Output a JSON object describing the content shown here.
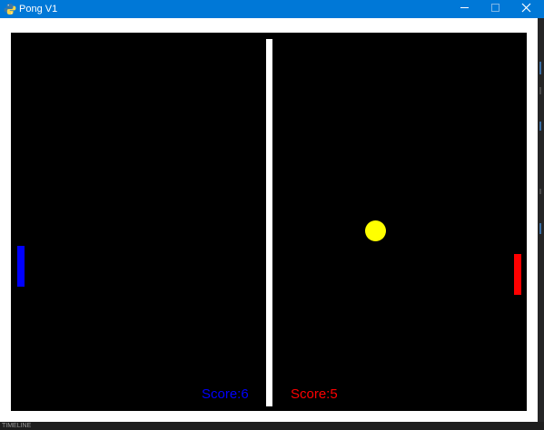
{
  "window": {
    "title": "Pong V1",
    "icon": "python-icon",
    "controls": [
      "minimize-icon",
      "maximize-icon",
      "close-icon"
    ],
    "titlebar_color": "#0078d7"
  },
  "game": {
    "court_color": "#000000",
    "border_color": "#ffffff",
    "net_color": "#ffffff",
    "left_player": {
      "score_text": "Score:6",
      "score": 6,
      "color": "#0000ff"
    },
    "right_player": {
      "score_text": "Score:5",
      "score": 5,
      "color": "#ff0000"
    },
    "ball_color": "#ffff00"
  },
  "background": {
    "bottom_label": "TIMELINE"
  }
}
